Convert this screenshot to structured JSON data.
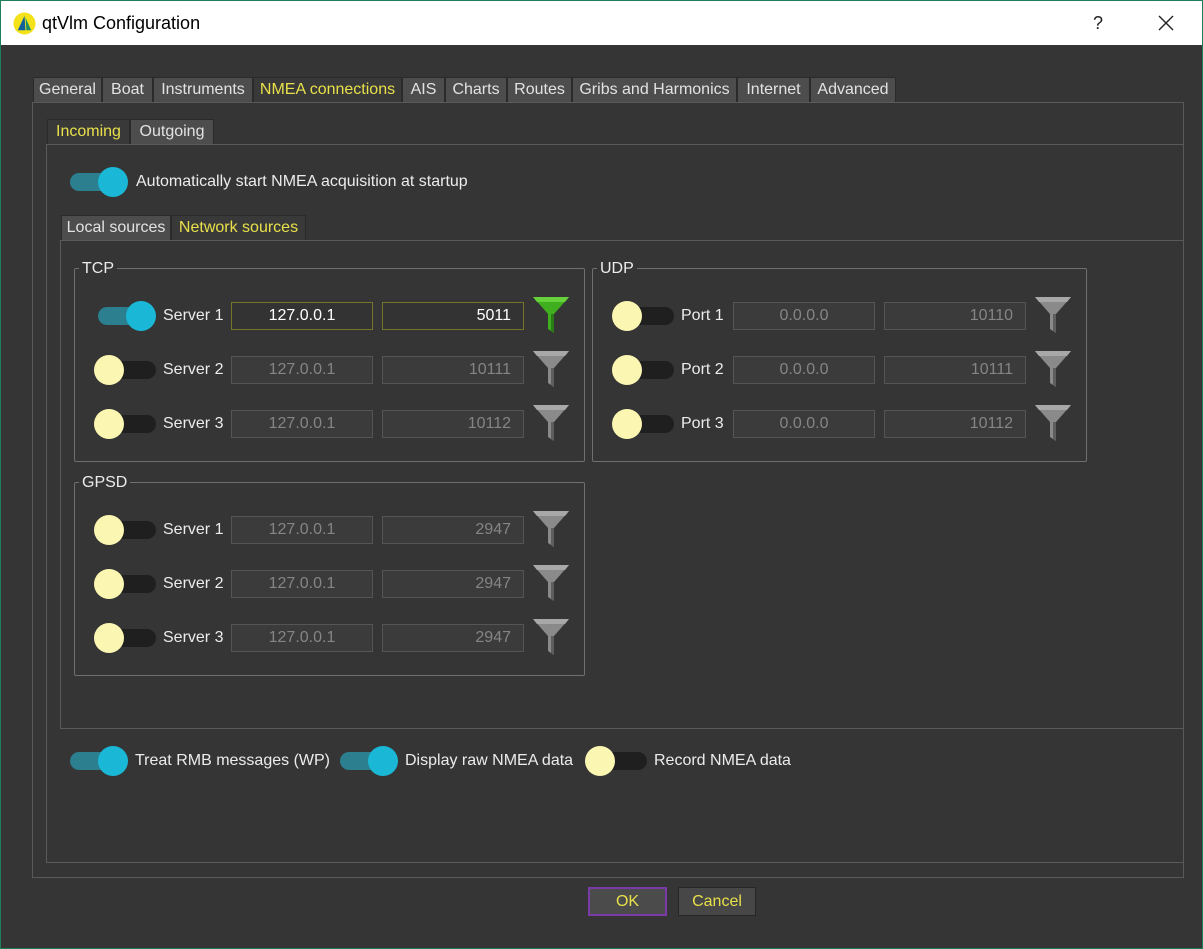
{
  "window": {
    "title": "qtVlm Configuration",
    "help_label": "?"
  },
  "tabs": [
    {
      "label": "General"
    },
    {
      "label": "Boat"
    },
    {
      "label": "Instruments"
    },
    {
      "label": "NMEA connections",
      "active": true
    },
    {
      "label": "AIS"
    },
    {
      "label": "Charts"
    },
    {
      "label": "Routes"
    },
    {
      "label": "Gribs and Harmonics"
    },
    {
      "label": "Internet"
    },
    {
      "label": "Advanced"
    }
  ],
  "subtabs": [
    {
      "label": "Incoming",
      "active": true
    },
    {
      "label": "Outgoing"
    }
  ],
  "auto_start": {
    "label": "Automatically start NMEA acquisition at startup",
    "on": true
  },
  "source_tabs": [
    {
      "label": "Local sources"
    },
    {
      "label": "Network sources",
      "active": true
    }
  ],
  "tcp": {
    "title": "TCP",
    "rows": [
      {
        "label": "Server 1",
        "on": true,
        "ip": "127.0.0.1",
        "port": "5011"
      },
      {
        "label": "Server 2",
        "on": false,
        "ip": "127.0.0.1",
        "port": "10111"
      },
      {
        "label": "Server 3",
        "on": false,
        "ip": "127.0.0.1",
        "port": "10112"
      }
    ]
  },
  "udp": {
    "title": "UDP",
    "rows": [
      {
        "label": "Port 1",
        "on": false,
        "ip": "0.0.0.0",
        "port": "10110"
      },
      {
        "label": "Port 2",
        "on": false,
        "ip": "0.0.0.0",
        "port": "10111"
      },
      {
        "label": "Port 3",
        "on": false,
        "ip": "0.0.0.0",
        "port": "10112"
      }
    ]
  },
  "gpsd": {
    "title": "GPSD",
    "rows": [
      {
        "label": "Server 1",
        "on": false,
        "ip": "127.0.0.1",
        "port": "2947"
      },
      {
        "label": "Server 2",
        "on": false,
        "ip": "127.0.0.1",
        "port": "2947"
      },
      {
        "label": "Server 3",
        "on": false,
        "ip": "127.0.0.1",
        "port": "2947"
      }
    ]
  },
  "bottom_options": {
    "treat_rmb": {
      "label": "Treat RMB messages (WP)",
      "on": true
    },
    "display_raw": {
      "label": "Display raw NMEA data",
      "on": true
    },
    "record": {
      "label": "Record NMEA data",
      "on": false
    }
  },
  "buttons": {
    "ok": "OK",
    "cancel": "Cancel"
  },
  "colors": {
    "accent_text": "#e8e04a",
    "toggle_on": "#1ab8d6",
    "toggle_off_knob": "#fbf6b2",
    "funnel_active": "#3fae1f",
    "funnel_inactive": "#8a8a8a",
    "ok_border": "#7a3ba8"
  },
  "icons": {
    "app": "qtvlm-sail-logo-icon",
    "close": "close-icon",
    "filter": "funnel-icon"
  }
}
